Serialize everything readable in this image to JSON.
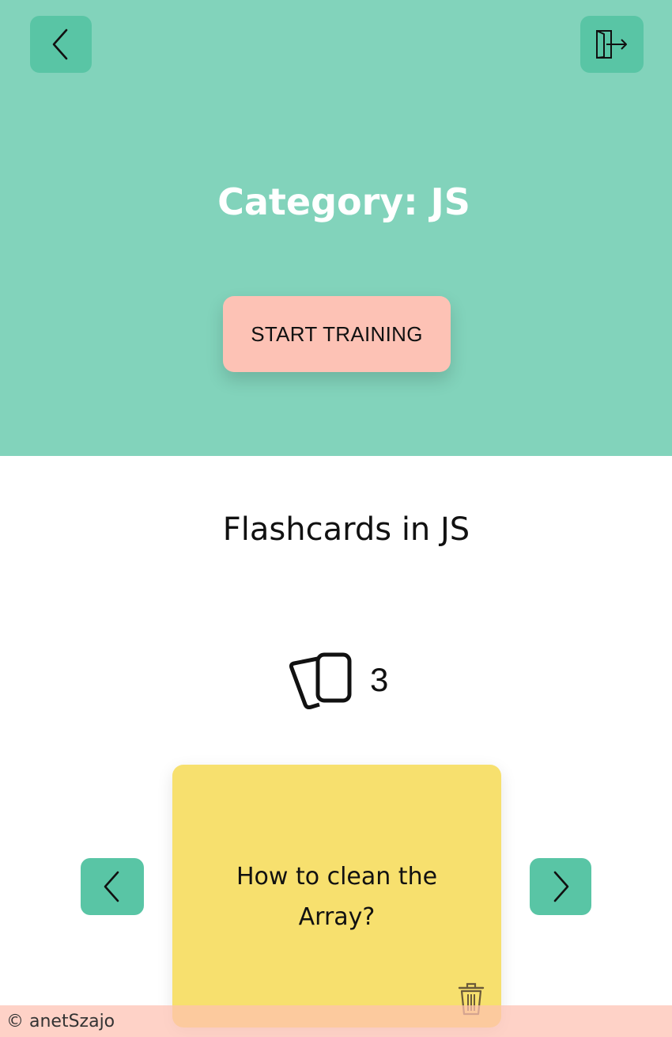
{
  "header": {
    "back_icon": "chevron-left-icon",
    "logout_icon": "logout-door-icon"
  },
  "hero": {
    "title": "Category: JS",
    "start_button_label": "START TRAINING"
  },
  "flashcards": {
    "section_title": "Flashcards in JS",
    "count_icon": "cards-stack-icon",
    "count": "3",
    "current_card": {
      "question": "How to clean the Array?",
      "delete_icon": "trash-icon"
    },
    "prev_icon": "chevron-left-icon",
    "next_icon": "chevron-right-icon"
  },
  "footer": {
    "copyright": "© anetSzajo"
  },
  "colors": {
    "hero_bg": "#82d3bb",
    "button_green": "#59c5a5",
    "start_button": "#fdc2b5",
    "card_yellow": "#f7e06e",
    "footer_bg": "#fdc0b2"
  }
}
